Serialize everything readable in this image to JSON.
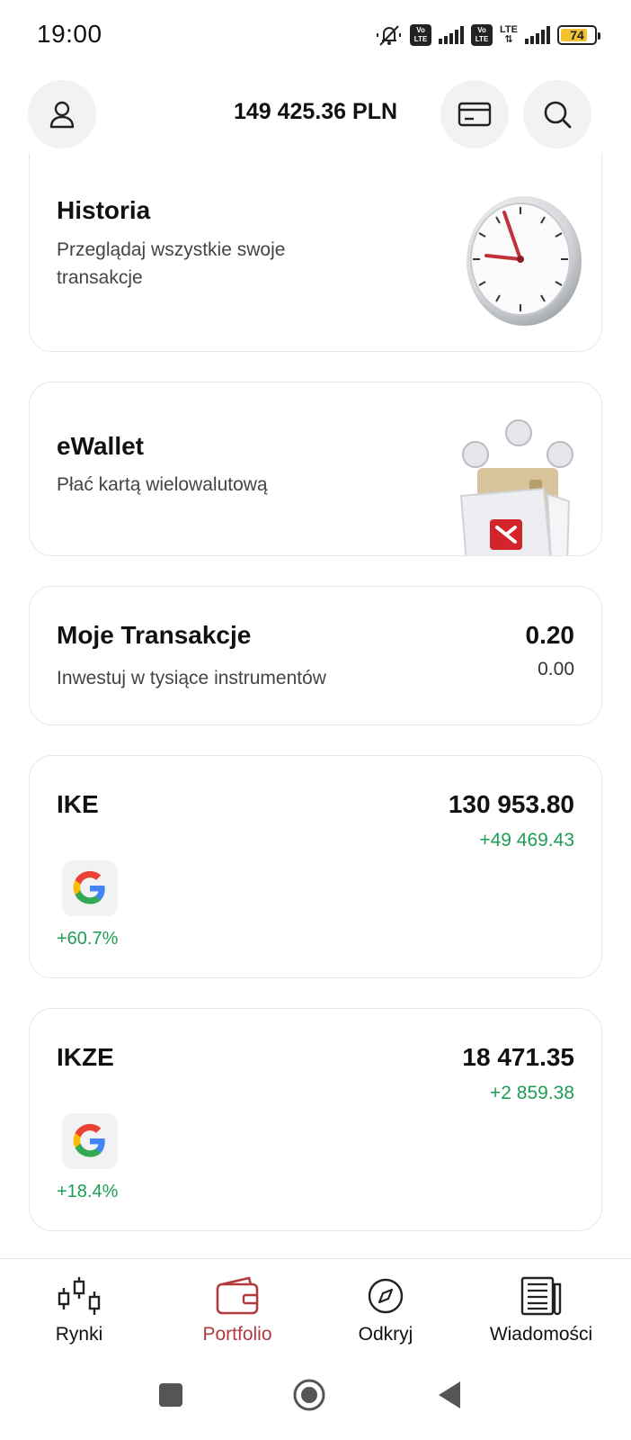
{
  "status_bar": {
    "time": "19:00",
    "volte_label_top": "Vo",
    "volte_label_bottom": "LTE",
    "lte_label": "LTE",
    "battery_level": "74"
  },
  "header": {
    "balance": "149 425.36 PLN",
    "profile_icon": "user-icon",
    "card_icon": "credit-card-icon",
    "search_icon": "search-icon"
  },
  "cards": {
    "historia": {
      "title": "Historia",
      "subtitle_line1": "Przeglądaj wszystkie swoje",
      "subtitle_line2": "transakcje"
    },
    "ewallet": {
      "title": "eWallet",
      "subtitle": "Płać kartą wielowalutową"
    },
    "moje_transakcje": {
      "title": "Moje Transakcje",
      "subtitle": "Inwestuj w tysiące instrumentów",
      "amount": "0.20",
      "change": "0.00"
    },
    "ike": {
      "title": "IKE",
      "amount": "130 953.80",
      "change": "+49 469.43",
      "holding_pct": "+60.7%"
    },
    "ikze": {
      "title": "IKZE",
      "amount": "18 471.35",
      "change": "+2 859.38",
      "holding_pct": "+18.4%"
    }
  },
  "nav": {
    "items": [
      {
        "label": "Rynki",
        "icon": "candlestick-icon"
      },
      {
        "label": "Portfolio",
        "icon": "wallet-icon",
        "active": true
      },
      {
        "label": "Odkryj",
        "icon": "compass-icon"
      },
      {
        "label": "Wiadomości",
        "icon": "newspaper-icon"
      }
    ]
  },
  "colors": {
    "positive": "#1f9d55",
    "accent": "#b03a3e",
    "card_border": "#e6e7ea",
    "button_bg": "#f1f2f4"
  }
}
